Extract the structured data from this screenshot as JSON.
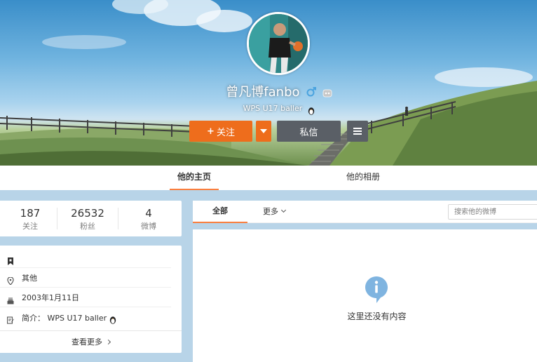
{
  "profile": {
    "name": "曾凡博fanbo",
    "bio": "WPS U17 baller"
  },
  "actions": {
    "follow_label": "关注",
    "message_label": "私信"
  },
  "tabs": [
    {
      "label": "他的主页",
      "active": true
    },
    {
      "label": "他的相册",
      "active": false
    }
  ],
  "stats": [
    {
      "value": "187",
      "label": "关注"
    },
    {
      "value": "26532",
      "label": "粉丝"
    },
    {
      "value": "4",
      "label": "微博"
    }
  ],
  "info": {
    "items": [
      {
        "icon": "bookmark-icon",
        "text": ""
      },
      {
        "icon": "location-icon",
        "text": "其他"
      },
      {
        "icon": "birthday-cake-icon",
        "text": "2003年1月11日"
      },
      {
        "icon": "edit-icon",
        "text": "简介： WPS U17 baller"
      }
    ],
    "more_label": "查看更多"
  },
  "feed": {
    "filter_all": "全部",
    "filter_more": "更多",
    "search_placeholder": "搜索他的微博",
    "empty_text": "这里还没有内容"
  },
  "colors": {
    "accent": "#ee6d1c",
    "tab_underline": "#fa7d3c",
    "dark_button": "#5a5f66",
    "page_bg": "#b8d4e8",
    "verified_blue": "#4aa3df",
    "empty_icon": "#7fb4e0"
  }
}
